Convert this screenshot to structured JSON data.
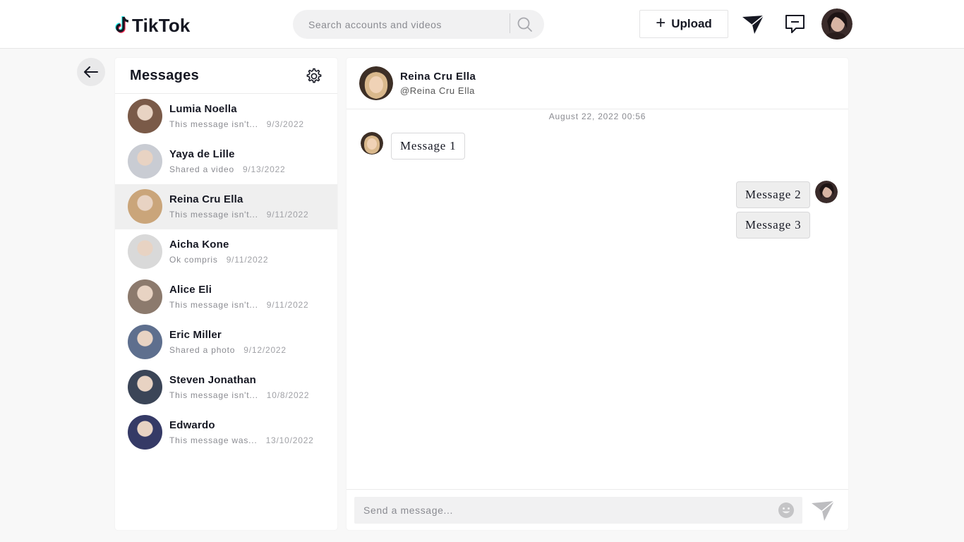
{
  "header": {
    "logo_text": "TikTok",
    "search_placeholder": "Search accounts and videos",
    "upload_label": "Upload",
    "icons": [
      "send-icon",
      "inbox-icon",
      "profile-avatar"
    ]
  },
  "sidebar": {
    "title": "Messages",
    "conversations": [
      {
        "name": "Lumia Noella",
        "preview": "This message isn't...",
        "date": "9/3/2022",
        "avatar_color": "#7a5a48"
      },
      {
        "name": "Yaya de Lille",
        "preview": "Shared a video",
        "date": "9/13/2022",
        "avatar_color": "#c9ccd3"
      },
      {
        "name": "Reina Cru Ella",
        "preview": "This message isn't...",
        "date": "9/11/2022",
        "avatar_color": "#caa57a"
      },
      {
        "name": "Aicha Kone",
        "preview": "Ok compris",
        "date": "9/11/2022",
        "avatar_color": "#d9d9d9"
      },
      {
        "name": "Alice Eli",
        "preview": "This message isn't...",
        "date": "9/11/2022",
        "avatar_color": "#8c7a6d"
      },
      {
        "name": "Eric Miller",
        "preview": "Shared a photo",
        "date": "9/12/2022",
        "avatar_color": "#5e6f8e"
      },
      {
        "name": "Steven Jonathan",
        "preview": "This message isn't...",
        "date": "10/8/2022",
        "avatar_color": "#3b4557"
      },
      {
        "name": "Edwardo",
        "preview": "This message was...",
        "date": "13/10/2022",
        "avatar_color": "#353a66"
      }
    ],
    "active_index": 2
  },
  "chat": {
    "name": "Reina Cru Ella",
    "handle": "@Reina Cru Ella",
    "timestamp": "August 22, 2022 00:56",
    "messages": [
      {
        "text": "Message 1",
        "direction": "in"
      },
      {
        "text": "Message 2",
        "direction": "out"
      },
      {
        "text": "Message 3",
        "direction": "out"
      }
    ],
    "composer_placeholder": "Send a message..."
  },
  "colors": {
    "brand_red": "#fe2c55",
    "brand_cyan": "#25f4ee",
    "active_row": "#efefef"
  }
}
